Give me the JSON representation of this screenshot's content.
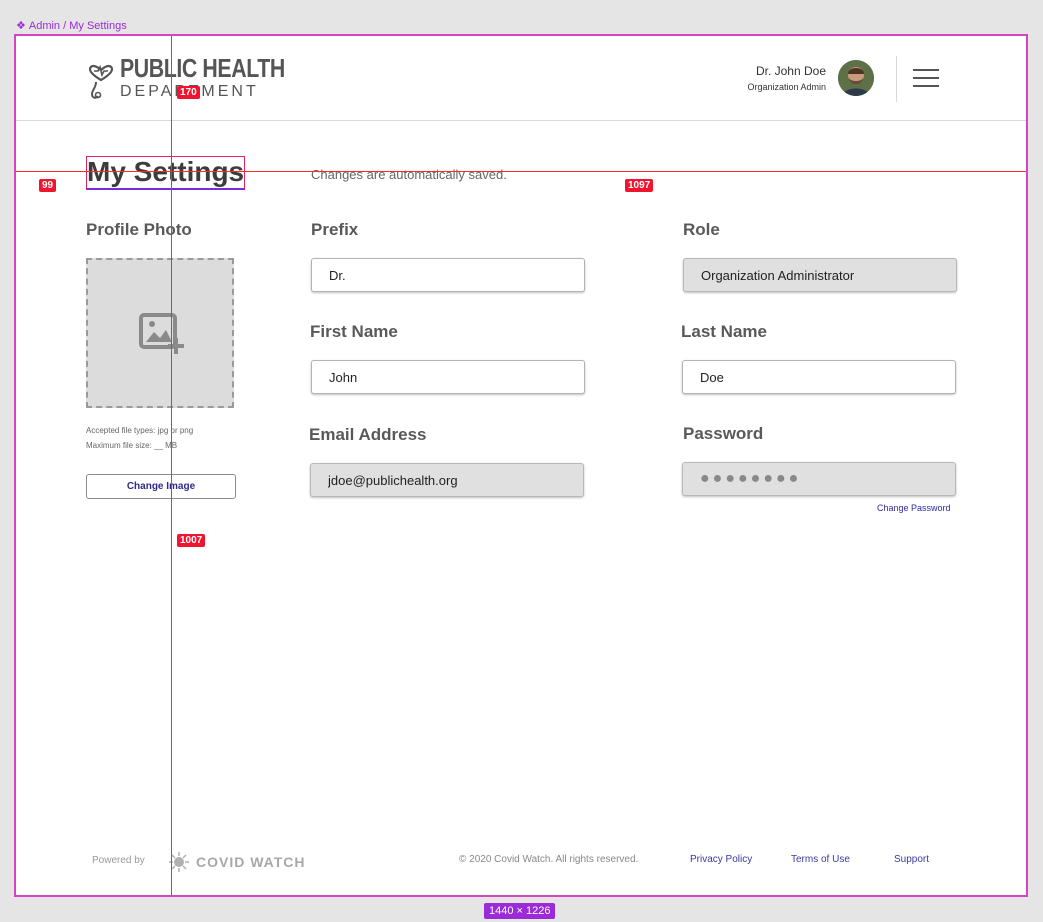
{
  "frame": {
    "label": "Admin / My Settings",
    "size_badge": "1440 × 1226"
  },
  "header": {
    "logo_line1": "PUBLIC HEALTH",
    "logo_line2": "DEPARTMENT",
    "user_name": "Dr. John Doe",
    "user_role": "Organization Admin"
  },
  "page": {
    "title": "My Settings",
    "autosave_note": "Changes are automatically saved."
  },
  "profile_photo": {
    "label": "Profile Photo",
    "accepted_types": "Accepted file types: jpg or png",
    "max_size": "Maximum file size: __ MB",
    "change_button": "Change Image"
  },
  "form": {
    "prefix": {
      "label": "Prefix",
      "value": "Dr."
    },
    "role": {
      "label": "Role",
      "value": "Organization Administrator"
    },
    "first_name": {
      "label": "First Name",
      "value": "John"
    },
    "last_name": {
      "label": "Last Name",
      "value": "Doe"
    },
    "email": {
      "label": "Email Address",
      "value": "jdoe@publichealth.org"
    },
    "password": {
      "label": "Password",
      "value": "●●●●●●●●",
      "change_link": "Change Password"
    }
  },
  "footer": {
    "powered_by": "Powered by",
    "brand": "COVID WATCH",
    "copyright": "© 2020 Covid Watch. All rights reserved.",
    "links": [
      "Privacy Policy",
      "Terms of Use",
      "Support"
    ]
  },
  "redline_measurements": [
    "170",
    "99",
    "1097",
    "1007"
  ],
  "colors": {
    "artboard_border": "#d743c0",
    "redline": "#ff2b2b",
    "link": "#2e2aa0"
  }
}
